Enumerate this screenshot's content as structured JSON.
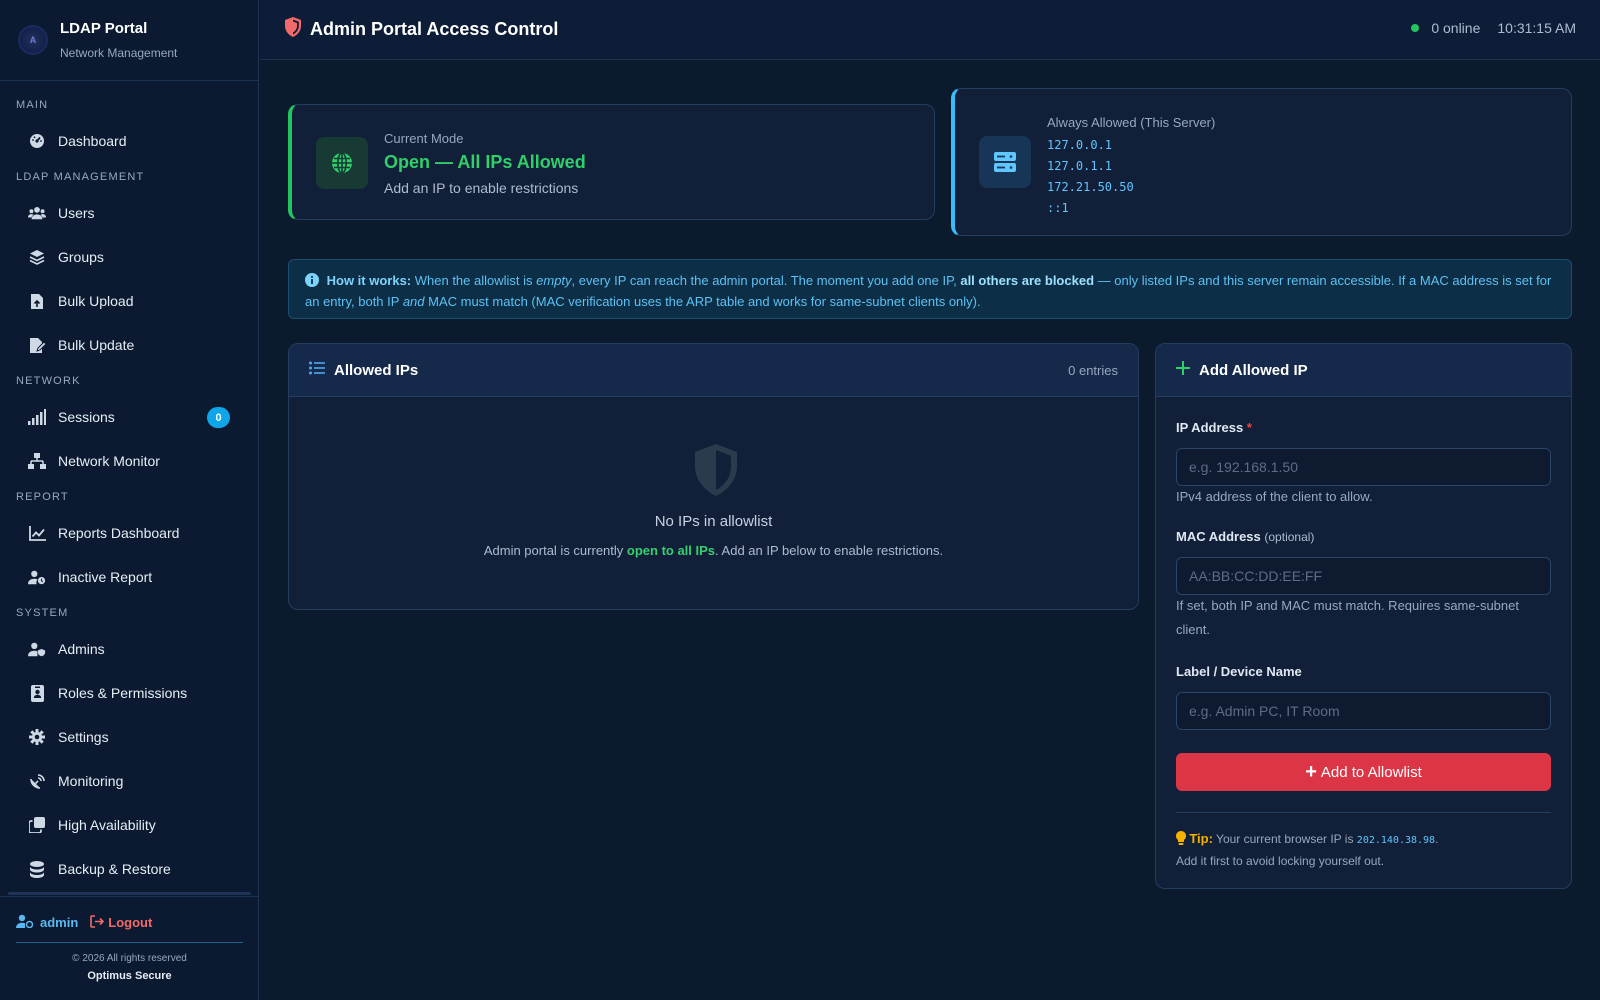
{
  "brand": {
    "title": "LDAP Portal",
    "subtitle": "Network Management",
    "logo_text": "A"
  },
  "sidebar": {
    "sections": {
      "main": "MAIN",
      "ldap": "LDAP MANAGEMENT",
      "network": "NETWORK",
      "report": "REPORT",
      "system": "SYSTEM"
    },
    "items": {
      "dashboard": "Dashboard",
      "users": "Users",
      "groups": "Groups",
      "bulk_upload": "Bulk Upload",
      "bulk_update": "Bulk Update",
      "sessions": "Sessions",
      "sessions_badge": "0",
      "network_monitor": "Network Monitor",
      "reports_dashboard": "Reports Dashboard",
      "inactive_report": "Inactive Report",
      "admins": "Admins",
      "roles": "Roles & Permissions",
      "settings": "Settings",
      "monitoring": "Monitoring",
      "high_availability": "High Availability",
      "backup_restore": "Backup & Restore"
    },
    "footer": {
      "user": "admin",
      "logout": "Logout",
      "copyright": "© 2026 All rights reserved",
      "company": "Optimus Secure"
    }
  },
  "header": {
    "title": "Admin Portal Access Control",
    "online": "0 online",
    "time": "10:31:15 AM"
  },
  "mode": {
    "label": "Current Mode",
    "value": "Open — All IPs Allowed",
    "hint": "Add an IP to enable restrictions"
  },
  "always_allowed": {
    "label": "Always Allowed (This Server)",
    "ips": [
      "127.0.0.1",
      "127.0.1.1",
      "172.21.50.50",
      "::1"
    ]
  },
  "info": {
    "lead": "How it works:",
    "t1": " When the allowlist is ",
    "empty": "empty",
    "t2": ", every IP can reach the admin portal. The moment you add one IP, ",
    "blocked": "all others are blocked",
    "t3": " — only listed IPs and this server remain accessible. If a MAC address is set for an entry, both IP ",
    "and": "and",
    "t4": " MAC must match (MAC verification uses the ARP table and works for same-subnet clients only)."
  },
  "allowed_ips": {
    "title": "Allowed IPs",
    "entries": "0 entries",
    "empty_title": "No IPs in allowlist",
    "empty_pre": "Admin portal is currently ",
    "empty_strong": "open to all IPs",
    "empty_post": ". Add an IP below to enable restrictions."
  },
  "add_ip": {
    "title": "Add Allowed IP",
    "ip_label": "IP Address",
    "ip_required": "*",
    "ip_placeholder": "e.g. 192.168.1.50",
    "ip_help": "IPv4 address of the client to allow.",
    "mac_label": "MAC Address",
    "mac_optional": "(optional)",
    "mac_placeholder": "AA:BB:CC:DD:EE:FF",
    "mac_help": "If set, both IP and MAC must match. Requires same-subnet client.",
    "name_label": "Label / Device Name",
    "name_placeholder": "e.g. Admin PC, IT Room",
    "button": "Add to Allowlist",
    "tip_label": "Tip:",
    "tip_pre": " Your current browser IP is ",
    "tip_ip": "202.140.38.98",
    "tip_post": ".",
    "tip_line2": "Add it first to avoid locking yourself out."
  },
  "colors": {
    "background": "#0c1a2e",
    "accent_green": "#22c55e",
    "accent_blue": "#38bdf8",
    "danger": "#dc3545",
    "badge": "#0ea5e9"
  }
}
